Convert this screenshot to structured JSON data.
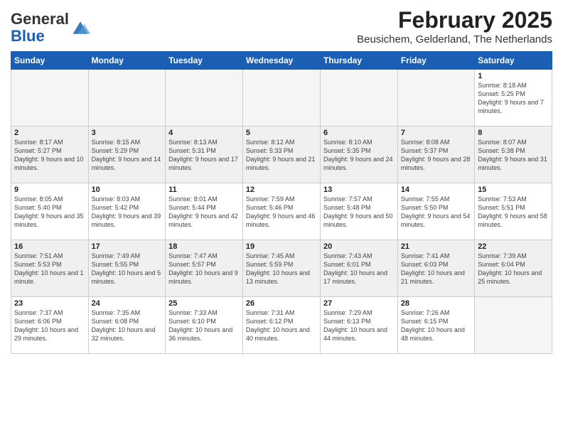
{
  "header": {
    "logo_general": "General",
    "logo_blue": "Blue",
    "month_year": "February 2025",
    "location": "Beusichem, Gelderland, The Netherlands"
  },
  "days_of_week": [
    "Sunday",
    "Monday",
    "Tuesday",
    "Wednesday",
    "Thursday",
    "Friday",
    "Saturday"
  ],
  "weeks": [
    [
      {
        "num": "",
        "info": ""
      },
      {
        "num": "",
        "info": ""
      },
      {
        "num": "",
        "info": ""
      },
      {
        "num": "",
        "info": ""
      },
      {
        "num": "",
        "info": ""
      },
      {
        "num": "",
        "info": ""
      },
      {
        "num": "1",
        "info": "Sunrise: 8:18 AM\nSunset: 5:25 PM\nDaylight: 9 hours and 7 minutes."
      }
    ],
    [
      {
        "num": "2",
        "info": "Sunrise: 8:17 AM\nSunset: 5:27 PM\nDaylight: 9 hours and 10 minutes."
      },
      {
        "num": "3",
        "info": "Sunrise: 8:15 AM\nSunset: 5:29 PM\nDaylight: 9 hours and 14 minutes."
      },
      {
        "num": "4",
        "info": "Sunrise: 8:13 AM\nSunset: 5:31 PM\nDaylight: 9 hours and 17 minutes."
      },
      {
        "num": "5",
        "info": "Sunrise: 8:12 AM\nSunset: 5:33 PM\nDaylight: 9 hours and 21 minutes."
      },
      {
        "num": "6",
        "info": "Sunrise: 8:10 AM\nSunset: 5:35 PM\nDaylight: 9 hours and 24 minutes."
      },
      {
        "num": "7",
        "info": "Sunrise: 8:08 AM\nSunset: 5:37 PM\nDaylight: 9 hours and 28 minutes."
      },
      {
        "num": "8",
        "info": "Sunrise: 8:07 AM\nSunset: 5:38 PM\nDaylight: 9 hours and 31 minutes."
      }
    ],
    [
      {
        "num": "9",
        "info": "Sunrise: 8:05 AM\nSunset: 5:40 PM\nDaylight: 9 hours and 35 minutes."
      },
      {
        "num": "10",
        "info": "Sunrise: 8:03 AM\nSunset: 5:42 PM\nDaylight: 9 hours and 39 minutes."
      },
      {
        "num": "11",
        "info": "Sunrise: 8:01 AM\nSunset: 5:44 PM\nDaylight: 9 hours and 42 minutes."
      },
      {
        "num": "12",
        "info": "Sunrise: 7:59 AM\nSunset: 5:46 PM\nDaylight: 9 hours and 46 minutes."
      },
      {
        "num": "13",
        "info": "Sunrise: 7:57 AM\nSunset: 5:48 PM\nDaylight: 9 hours and 50 minutes."
      },
      {
        "num": "14",
        "info": "Sunrise: 7:55 AM\nSunset: 5:50 PM\nDaylight: 9 hours and 54 minutes."
      },
      {
        "num": "15",
        "info": "Sunrise: 7:53 AM\nSunset: 5:51 PM\nDaylight: 9 hours and 58 minutes."
      }
    ],
    [
      {
        "num": "16",
        "info": "Sunrise: 7:51 AM\nSunset: 5:53 PM\nDaylight: 10 hours and 1 minute."
      },
      {
        "num": "17",
        "info": "Sunrise: 7:49 AM\nSunset: 5:55 PM\nDaylight: 10 hours and 5 minutes."
      },
      {
        "num": "18",
        "info": "Sunrise: 7:47 AM\nSunset: 5:57 PM\nDaylight: 10 hours and 9 minutes."
      },
      {
        "num": "19",
        "info": "Sunrise: 7:45 AM\nSunset: 5:59 PM\nDaylight: 10 hours and 13 minutes."
      },
      {
        "num": "20",
        "info": "Sunrise: 7:43 AM\nSunset: 6:01 PM\nDaylight: 10 hours and 17 minutes."
      },
      {
        "num": "21",
        "info": "Sunrise: 7:41 AM\nSunset: 6:03 PM\nDaylight: 10 hours and 21 minutes."
      },
      {
        "num": "22",
        "info": "Sunrise: 7:39 AM\nSunset: 6:04 PM\nDaylight: 10 hours and 25 minutes."
      }
    ],
    [
      {
        "num": "23",
        "info": "Sunrise: 7:37 AM\nSunset: 6:06 PM\nDaylight: 10 hours and 29 minutes."
      },
      {
        "num": "24",
        "info": "Sunrise: 7:35 AM\nSunset: 6:08 PM\nDaylight: 10 hours and 32 minutes."
      },
      {
        "num": "25",
        "info": "Sunrise: 7:33 AM\nSunset: 6:10 PM\nDaylight: 10 hours and 36 minutes."
      },
      {
        "num": "26",
        "info": "Sunrise: 7:31 AM\nSunset: 6:12 PM\nDaylight: 10 hours and 40 minutes."
      },
      {
        "num": "27",
        "info": "Sunrise: 7:29 AM\nSunset: 6:13 PM\nDaylight: 10 hours and 44 minutes."
      },
      {
        "num": "28",
        "info": "Sunrise: 7:26 AM\nSunset: 6:15 PM\nDaylight: 10 hours and 48 minutes."
      },
      {
        "num": "",
        "info": ""
      }
    ]
  ]
}
